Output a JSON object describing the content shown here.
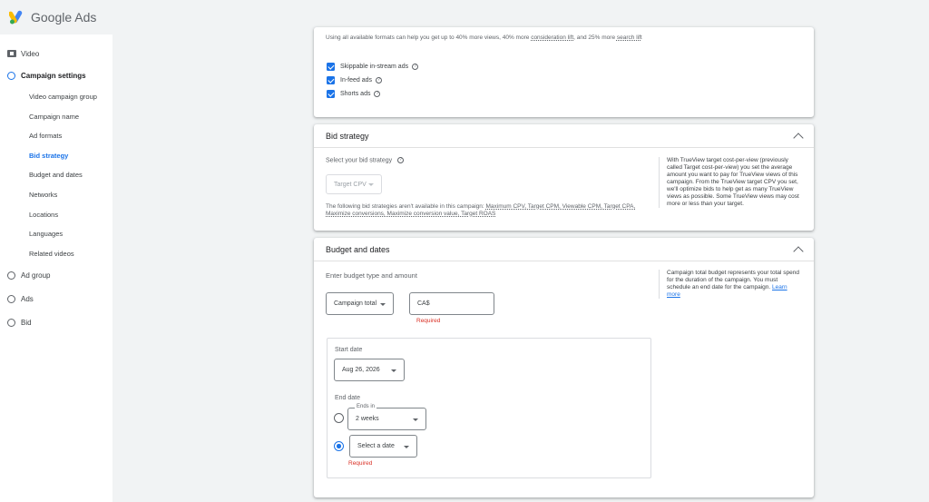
{
  "app": {
    "brand": "Google",
    "product": "Ads"
  },
  "sidebar": {
    "video_label": "Video",
    "campaign_settings": "Campaign settings",
    "sub_items": [
      "Video campaign group",
      "Campaign name",
      "Ad formats",
      "Bid strategy",
      "Budget and dates",
      "Networks",
      "Locations",
      "Languages",
      "Related videos"
    ],
    "ad_group": "Ad group",
    "ads": "Ads",
    "bid": "Bid"
  },
  "ad_formats": {
    "info_line1": "Using all available formats can help you get up to 40% more views, 40% more",
    "info_link1": "consideration lift",
    "info_mid": ", and 25% more",
    "info_link2": "search lift",
    "options": [
      "Skippable in-stream ads",
      "In-feed ads",
      "Shorts ads"
    ],
    "help_glyph": "?"
  },
  "bid_strategy": {
    "title": "Bid strategy",
    "select_label": "Select your bid strategy",
    "selected": "Target CPV",
    "unavailable_prefix": "The following bid strategies aren't available in this campaign:",
    "unavailable_line1": "Maximum CPV, Target CPM, Viewable CPM, Target CPA,",
    "unavailable_line2": "Maximize conversions, Maximize conversion value, Target ROAS",
    "help_text": "With TrueView target cost-per-view (previously called Target cost-per-view) you set the average amount you want to pay for TrueView views of this campaign. From the TrueView target CPV you set, we'll optimize bids to help get as many TrueView views as possible. Some TrueView views may cost more or less than your target."
  },
  "budget": {
    "title": "Budget and dates",
    "enter_label": "Enter budget type and amount",
    "type": "Campaign total",
    "amount_prefix": "CA$",
    "required": "Required",
    "help_text": "Campaign total budget represents your total spend for the duration of the campaign. You must schedule an end date for the campaign.",
    "learn_more": "Learn more",
    "start_date_label": "Start date",
    "start_date": "Aug 26, 2026",
    "end_date_label": "End date",
    "ends_in_label": "Ends in",
    "ends_in_value": "2 weeks",
    "select_date": "Select a date"
  },
  "colors": {
    "accent": "#1a73e8",
    "error": "#d93025"
  }
}
